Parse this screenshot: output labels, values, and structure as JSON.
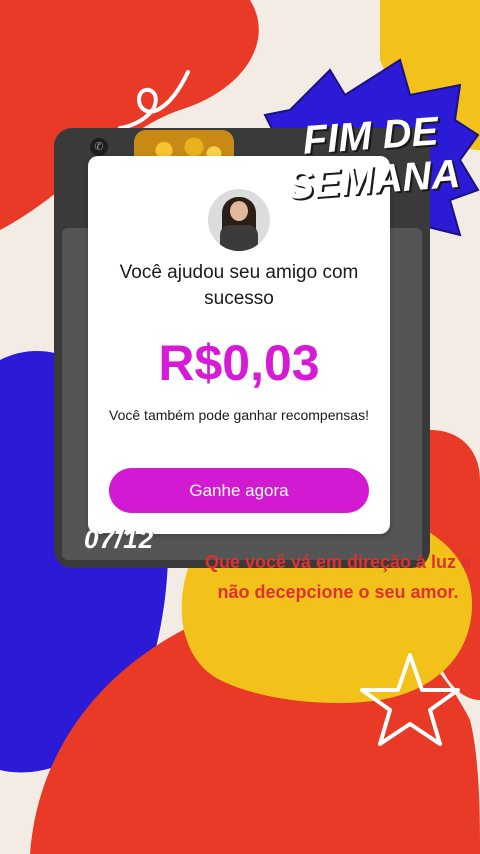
{
  "colors": {
    "accent": "#d61ad6",
    "red": "#e83a27",
    "blue": "#2b1bd6",
    "yellow": "#f2c21a",
    "cream": "#f3ece4"
  },
  "icons": [
    "phone-icon",
    "coins-image",
    "avatar-photo",
    "star-doodle"
  ],
  "card": {
    "title": "Você ajudou seu amigo com sucesso",
    "amount": "R$0,03",
    "subtitle": "Você também pode ganhar recompensas!",
    "button_label": "Ganhe agora"
  },
  "decor": {
    "headline": "FIM DE SEMANA",
    "date": "07/12",
    "quote": "Que você vá em direção à luz e não decepcione o seu amor."
  }
}
